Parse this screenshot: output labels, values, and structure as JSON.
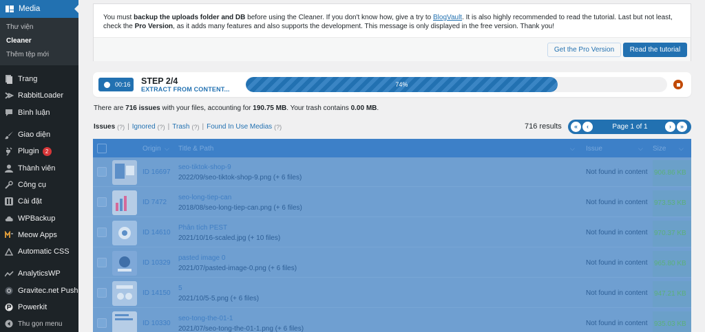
{
  "sidebar": {
    "media": {
      "label": "Media",
      "icon": "media-icon"
    },
    "submenu": [
      {
        "label": "Thư viện"
      },
      {
        "label": "Cleaner"
      },
      {
        "label": "Thêm tệp mới"
      }
    ],
    "items": [
      {
        "label": "Trang",
        "icon": "page-icon"
      },
      {
        "label": "RabbitLoader",
        "icon": "rabbit-icon"
      },
      {
        "label": "Bình luận",
        "icon": "comment-icon"
      },
      {
        "label": "Giao diện",
        "icon": "brush-icon"
      },
      {
        "label": "Plugin",
        "icon": "plugin-icon",
        "badge": "2"
      },
      {
        "label": "Thành viên",
        "icon": "user-icon"
      },
      {
        "label": "Công cụ",
        "icon": "wrench-icon"
      },
      {
        "label": "Cài đặt",
        "icon": "settings-icon"
      },
      {
        "label": "WPBackup",
        "icon": "cloud-icon"
      },
      {
        "label": "Meow Apps",
        "icon": "meow-icon"
      },
      {
        "label": "Automatic CSS",
        "icon": "triangle-icon"
      },
      {
        "label": "AnalyticsWP",
        "icon": "chart-icon"
      },
      {
        "label": "Gravitec.net Push",
        "icon": "gravitec-icon"
      },
      {
        "label": "Powerkit",
        "icon": "powerkit-icon"
      },
      {
        "label": "Thu gọn menu",
        "icon": "collapse-icon"
      }
    ]
  },
  "notice": {
    "text_1": "You must ",
    "text_bold_1": "backup the uploads folder and DB",
    "text_2": " before using the Cleaner. If you don't know how, give a try to ",
    "link": "BlogVault",
    "text_3": ". It is also highly recommended to read the tutorial. Last but not least, check the ",
    "text_bold_2": "Pro Version",
    "text_4": ", as it adds many features and also supports the development. This message is only displayed in the free version. Thank you!",
    "btn_pro": "Get the Pro Version",
    "btn_tutorial": "Read the tutorial"
  },
  "progress": {
    "timer": "00:16",
    "step": "STEP 2/4",
    "step_label": "EXTRACT FROM CONTENT...",
    "percent_label": "74%",
    "percent": 74
  },
  "summary": {
    "t1": "There are ",
    "issues": "716 issues",
    "t2": " with your files, accounting for ",
    "size": "190.75 MB",
    "t3": ". Your trash contains ",
    "trash": "0.00 MB",
    "t4": "."
  },
  "tabs": [
    {
      "label": "Issues",
      "count": "(?)"
    },
    {
      "label": "Ignored",
      "count": "(?)"
    },
    {
      "label": "Trash",
      "count": "(?)"
    },
    {
      "label": "Found In Use Medias",
      "count": "(?)"
    }
  ],
  "results": "716 results",
  "pager": {
    "label": "Page 1 of 1",
    "first": "«",
    "prev": "‹",
    "next": "›",
    "last": "»"
  },
  "table": {
    "headers": {
      "origin": "Origin",
      "title": "Title & Path",
      "issue": "Issue",
      "size": "Size"
    },
    "rows": [
      {
        "id": "ID 16697",
        "title": "seo-tiktok-shop-9",
        "path": "2022/09/seo-tiktok-shop-9.png (+ 6 files)",
        "issue": "Not found in content",
        "size": "906.86 KB"
      },
      {
        "id": "ID 7472",
        "title": "seo-long-tiep-can",
        "path": "2018/08/seo-long-tiep-can.png (+ 6 files)",
        "issue": "Not found in content",
        "size": "973.53 KB"
      },
      {
        "id": "ID 14610",
        "title": "Phân tích PEST",
        "path": "2021/10/16-scaled.jpg (+ 10 files)",
        "issue": "Not found in content",
        "size": "970.37 KB"
      },
      {
        "id": "ID 10329",
        "title": "pasted image 0",
        "path": "2021/07/pasted-image-0.png (+ 6 files)",
        "issue": "Not found in content",
        "size": "965.80 KB"
      },
      {
        "id": "ID 14150",
        "title": "5",
        "path": "2021/10/5-5.png (+ 6 files)",
        "issue": "Not found in content",
        "size": "947.21 KB"
      },
      {
        "id": "ID 10330",
        "title": "seo-tong-the-01-1",
        "path": "2021/07/seo-tong-the-01-1.png (+ 6 files)",
        "issue": "Not found in content",
        "size": "935.03 KB"
      }
    ]
  },
  "colors": {
    "accent": "#2271b1",
    "sidebar": "#1d2327",
    "stop": "#c14a05",
    "badge": "#d63638"
  }
}
